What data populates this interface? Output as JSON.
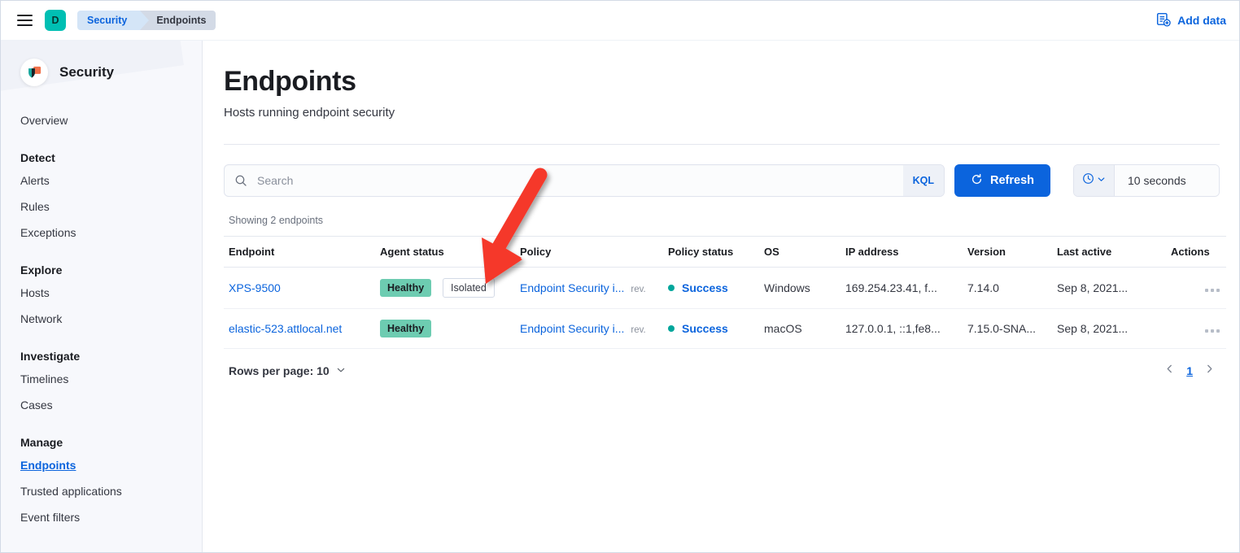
{
  "chrome": {
    "menu_icon": "hamburger-icon",
    "avatar_initial": "D",
    "avatar_color": "#00bfb3",
    "breadcrumbs": [
      {
        "label": "Security",
        "active": false
      },
      {
        "label": "Endpoints",
        "active": true
      }
    ],
    "add_data_label": "Add data",
    "add_data_icon": "add-data-icon"
  },
  "sidebar": {
    "brand": "Security",
    "brand_icon": "elastic-security-logo",
    "top_links": [
      {
        "label": "Overview"
      }
    ],
    "groups": [
      {
        "title": "Detect",
        "items": [
          {
            "label": "Alerts",
            "active": false
          },
          {
            "label": "Rules",
            "active": false
          },
          {
            "label": "Exceptions",
            "active": false
          }
        ]
      },
      {
        "title": "Explore",
        "items": [
          {
            "label": "Hosts",
            "active": false
          },
          {
            "label": "Network",
            "active": false
          }
        ]
      },
      {
        "title": "Investigate",
        "items": [
          {
            "label": "Timelines",
            "active": false
          },
          {
            "label": "Cases",
            "active": false
          }
        ]
      },
      {
        "title": "Manage",
        "items": [
          {
            "label": "Endpoints",
            "active": true
          },
          {
            "label": "Trusted applications",
            "active": false
          },
          {
            "label": "Event filters",
            "active": false
          }
        ]
      }
    ]
  },
  "main": {
    "title": "Endpoints",
    "subtitle": "Hosts running endpoint security",
    "search": {
      "placeholder": "Search",
      "value": "",
      "query_language": "KQL",
      "search_icon": "search-icon"
    },
    "refresh": {
      "label": "Refresh",
      "icon": "refresh-icon",
      "accent": "#0b64dd"
    },
    "datepicker": {
      "icon": "clock-icon",
      "chevron": "chevron-down-icon",
      "value": "10 seconds"
    },
    "showing": "Showing 2 endpoints",
    "columns": [
      "Endpoint",
      "Agent status",
      "Policy",
      "Policy status",
      "OS",
      "IP address",
      "Version",
      "Last active",
      "Actions"
    ],
    "rows": [
      {
        "endpoint": "XPS-9500",
        "agent_status": "Healthy",
        "agent_isolated": "Isolated",
        "policy": "Endpoint Security i...",
        "policy_rev": "rev.",
        "policy_status": "Success",
        "os": "Windows",
        "ip": "169.254.23.41, f...",
        "version": "7.14.0",
        "last_active": "Sep 8, 2021...",
        "actions_icon": "more-actions-icon"
      },
      {
        "endpoint": "elastic-523.attlocal.net",
        "agent_status": "Healthy",
        "agent_isolated": "",
        "policy": "Endpoint Security i...",
        "policy_rev": "rev.",
        "policy_status": "Success",
        "os": "macOS",
        "ip": "127.0.0.1, ::1,fe8...",
        "version": "7.15.0-SNA...",
        "last_active": "Sep 8, 2021...",
        "actions_icon": "more-actions-icon"
      }
    ],
    "footer": {
      "rows_per_page_label": "Rows per page: 10",
      "rows_per_page_chevron": "chevron-down-icon",
      "prev_icon": "chevron-left-icon",
      "next_icon": "chevron-right-icon",
      "current_page": "1"
    }
  },
  "annotation": {
    "type": "arrow",
    "color": "#f5382c",
    "points_to": "isolated-badge"
  }
}
